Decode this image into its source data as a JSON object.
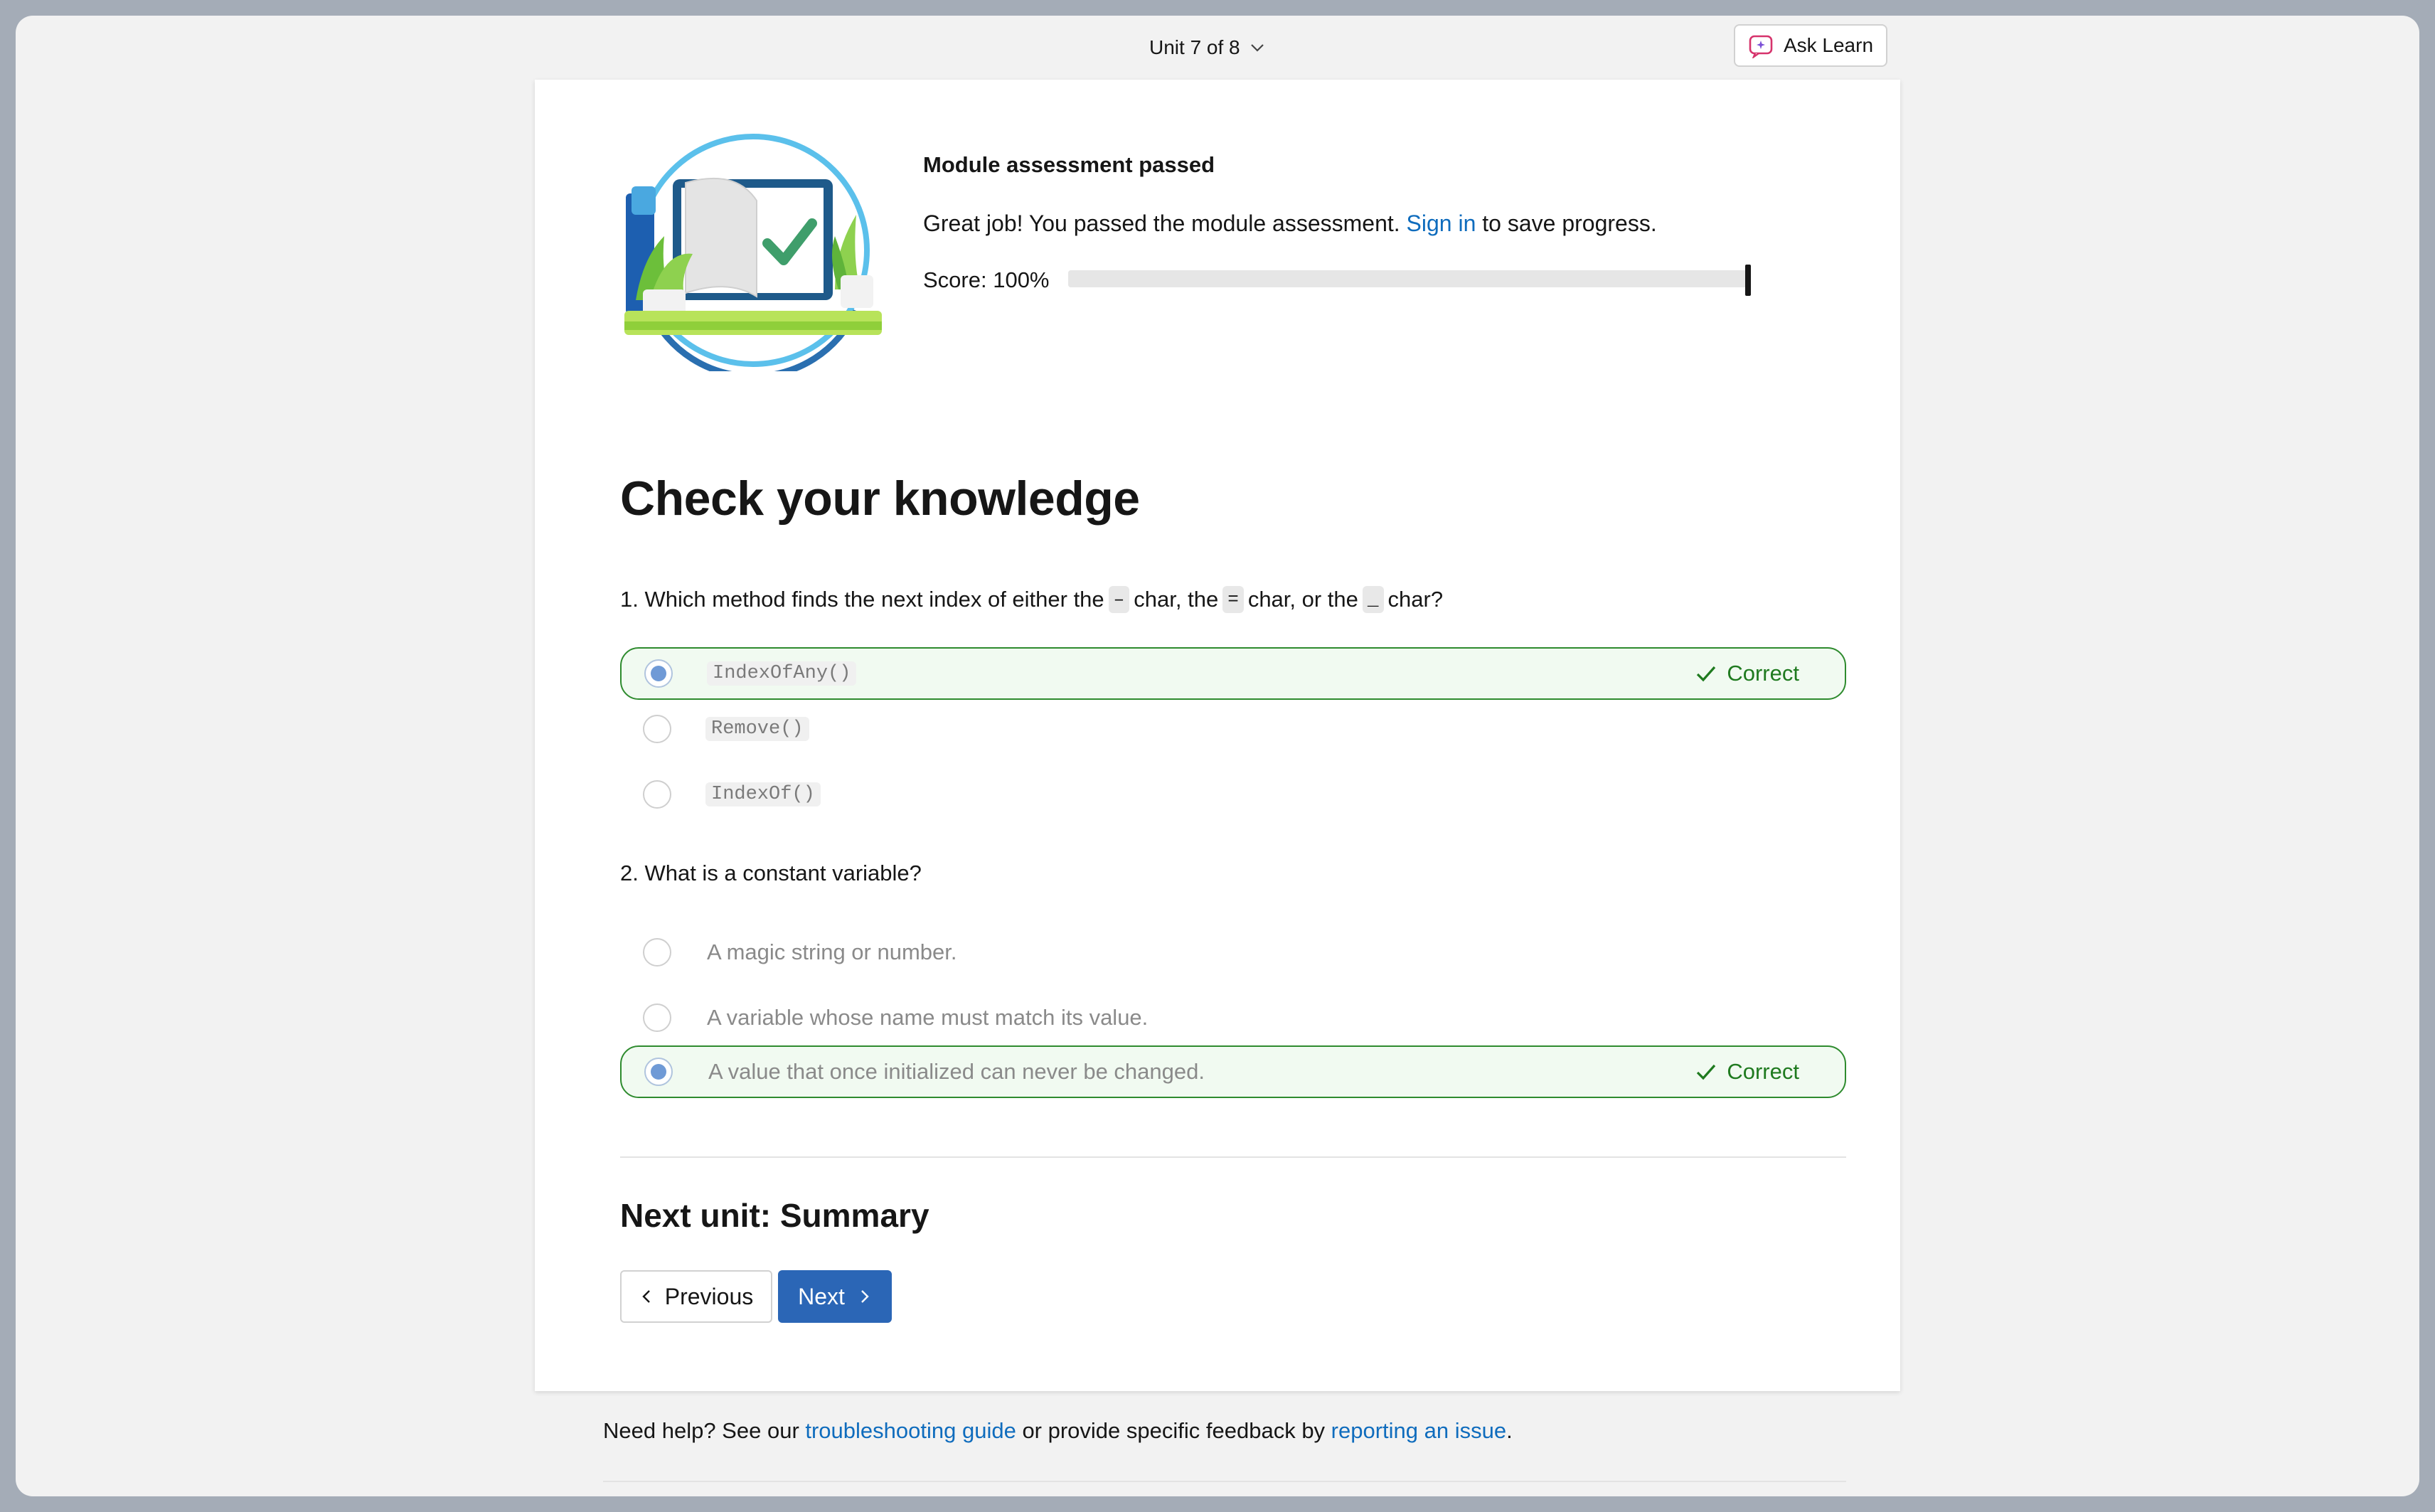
{
  "topbar": {
    "unit_label": "Unit 7 of 8",
    "ask_learn_label": "Ask Learn"
  },
  "assessment": {
    "title": "Module assessment passed",
    "message_prefix": "Great job! You passed the module assessment. ",
    "sign_in_link": "Sign in",
    "message_suffix": " to save progress.",
    "score_label": "Score: 100%",
    "score_fraction": 1.0
  },
  "heading": "Check your knowledge",
  "questions": [
    {
      "prompt_parts": [
        "1. Which method finds the next index of either the",
        "–",
        "char, the",
        "=",
        "char, or the",
        "_",
        "char?"
      ],
      "options": [
        {
          "label": "IndexOfAny()",
          "selected": true,
          "status": "Correct"
        },
        {
          "label": "Remove()",
          "selected": false
        },
        {
          "label": "IndexOf()",
          "selected": false
        }
      ]
    },
    {
      "prompt": "2. What is a constant variable?",
      "options": [
        {
          "label": "A magic string or number.",
          "selected": false
        },
        {
          "label": "A variable whose name must match its value.",
          "selected": false
        },
        {
          "label": "A value that once initialized can never be changed.",
          "selected": true,
          "status": "Correct"
        }
      ]
    }
  ],
  "next_unit": {
    "title": "Next unit: Summary",
    "previous_label": "Previous",
    "next_label": "Next"
  },
  "help": {
    "prefix": "Need help? See our ",
    "troubleshooting_link": "troubleshooting guide",
    "middle": " or provide specific feedback by ",
    "report_link": "reporting an issue",
    "suffix": "."
  },
  "colors": {
    "accent": "#0f6cbd",
    "correct": "#1f7a1f",
    "primary_button": "#2b66b6"
  }
}
